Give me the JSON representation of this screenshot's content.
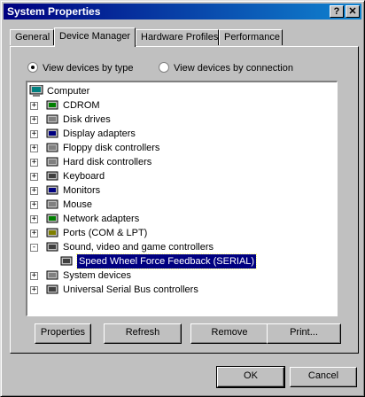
{
  "window": {
    "title": "System Properties",
    "help_label": "?",
    "close_label": "✕"
  },
  "tabs": [
    {
      "label": "General"
    },
    {
      "label": "Device Manager"
    },
    {
      "label": "Hardware Profiles"
    },
    {
      "label": "Performance"
    }
  ],
  "view_options": {
    "by_type": {
      "label": "View devices by type",
      "selected": true
    },
    "by_connection": {
      "label": "View devices by connection",
      "selected": false
    }
  },
  "tree": {
    "root": {
      "label": "Computer",
      "icon": "computer-icon"
    },
    "items": [
      {
        "label": "CDROM",
        "icon": "cdrom-icon",
        "expander": "+"
      },
      {
        "label": "Disk drives",
        "icon": "disk-drive-icon",
        "expander": "+"
      },
      {
        "label": "Display adapters",
        "icon": "display-adapter-icon",
        "expander": "+"
      },
      {
        "label": "Floppy disk controllers",
        "icon": "floppy-controller-icon",
        "expander": "+"
      },
      {
        "label": "Hard disk controllers",
        "icon": "hard-disk-controller-icon",
        "expander": "+"
      },
      {
        "label": "Keyboard",
        "icon": "keyboard-icon",
        "expander": "+"
      },
      {
        "label": "Monitors",
        "icon": "monitor-icon",
        "expander": "+"
      },
      {
        "label": "Mouse",
        "icon": "mouse-icon",
        "expander": "+"
      },
      {
        "label": "Network adapters",
        "icon": "network-adapter-icon",
        "expander": "+"
      },
      {
        "label": "Ports (COM & LPT)",
        "icon": "port-icon",
        "expander": "+"
      },
      {
        "label": "Sound, video and game controllers",
        "icon": "sound-controller-icon",
        "expander": "-"
      },
      {
        "label": "Speed Wheel Force Feedback (SERIAL)",
        "icon": "game-controller-icon",
        "expander": "",
        "child": true,
        "selected": true
      },
      {
        "label": "System devices",
        "icon": "system-devices-icon",
        "expander": "+"
      },
      {
        "label": "Universal Serial Bus controllers",
        "icon": "usb-icon",
        "expander": "+"
      }
    ]
  },
  "buttons": {
    "properties": "Properties",
    "refresh": "Refresh",
    "remove": "Remove",
    "print": "Print...",
    "ok": "OK",
    "cancel": "Cancel"
  },
  "colors": {
    "title_start": "#000080",
    "title_end": "#1084d0",
    "selection": "#000080",
    "face": "#c0c0c0"
  }
}
